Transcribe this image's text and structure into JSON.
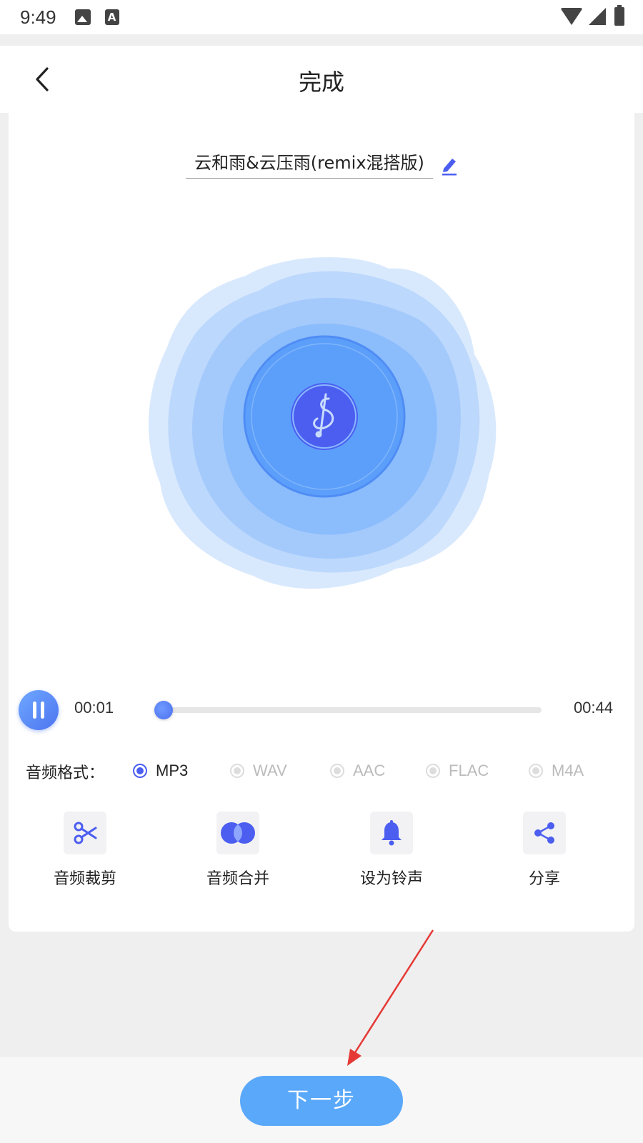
{
  "status_bar": {
    "time": "9:49",
    "badge_letter": "A"
  },
  "header": {
    "title": "完成"
  },
  "file": {
    "name": "云和雨&云压雨(remix混搭版)"
  },
  "player": {
    "current_time": "00:01",
    "total_time": "00:44",
    "progress_fraction": 0.02,
    "state": "playing"
  },
  "format": {
    "label": "音频格式：",
    "options": [
      {
        "label": "MP3",
        "selected": true
      },
      {
        "label": "WAV",
        "selected": false
      },
      {
        "label": "AAC",
        "selected": false
      },
      {
        "label": "FLAC",
        "selected": false
      },
      {
        "label": "M4A",
        "selected": false
      }
    ]
  },
  "tools": [
    {
      "label": "音频裁剪",
      "icon": "scissors-icon"
    },
    {
      "label": "音频合并",
      "icon": "merge-icon"
    },
    {
      "label": "设为铃声",
      "icon": "bell-icon"
    },
    {
      "label": "分享",
      "icon": "share-icon"
    }
  ],
  "footer": {
    "next_label": "下一步"
  },
  "colors": {
    "accent": "#4c5ef0",
    "button": "#5aa8fa",
    "disc": "#5aa3fb",
    "annotation_arrow": "#e53935"
  }
}
